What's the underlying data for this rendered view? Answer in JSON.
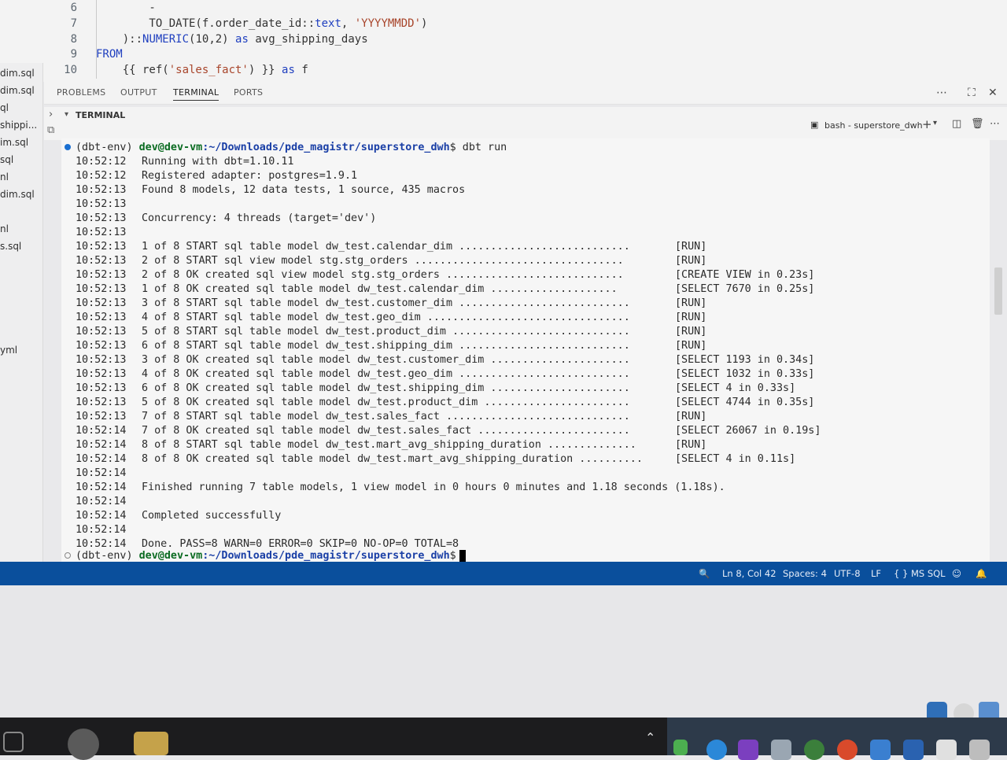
{
  "editor": {
    "lines": [
      {
        "num": "6",
        "parts": [
          {
            "t": "        -",
            "c": "fn"
          }
        ]
      },
      {
        "num": "7",
        "parts": [
          {
            "t": "        TO_DATE(f.order_date_id::",
            "c": "fn"
          },
          {
            "t": "text",
            "c": "kw"
          },
          {
            "t": ", ",
            "c": "fn"
          },
          {
            "t": "'YYYYMMDD'",
            "c": "str"
          },
          {
            "t": ")",
            "c": "fn"
          }
        ]
      },
      {
        "num": "8",
        "parts": [
          {
            "t": "    )::",
            "c": "fn"
          },
          {
            "t": "NUMERIC",
            "c": "kw"
          },
          {
            "t": "(10,2) ",
            "c": "fn"
          },
          {
            "t": "as",
            "c": "kw"
          },
          {
            "t": " avg_shipping_days",
            "c": "fn"
          }
        ]
      },
      {
        "num": "9",
        "parts": [
          {
            "t": "FROM",
            "c": "kw"
          }
        ]
      },
      {
        "num": "10",
        "parts": [
          {
            "t": "    {{ ref(",
            "c": "fn"
          },
          {
            "t": "'sales_fact'",
            "c": "str"
          },
          {
            "t": ") }} ",
            "c": "fn"
          },
          {
            "t": "as",
            "c": "kw"
          },
          {
            "t": " f",
            "c": "fn"
          }
        ]
      }
    ]
  },
  "explorer": {
    "items": [
      "dim.sql",
      "dim.sql",
      "ql",
      "shippi...",
      "im.sql",
      "sql",
      "nl",
      "dim.sql",
      "nl",
      "s.sql",
      "yml"
    ]
  },
  "panel": {
    "tabs": [
      "PROBLEMS",
      "OUTPUT",
      "TERMINAL",
      "PORTS"
    ],
    "active_tab": "TERMINAL",
    "terminal_section_label": "TERMINAL",
    "terminal_instance": "bash - superstore_dwh"
  },
  "terminal": {
    "prompt_env": "(dbt-env)",
    "prompt_user": "dev@dev-vm",
    "prompt_path": ":~/Downloads/pde_magistr/superstore_dwh",
    "prompt_symbol": "$",
    "command": " dbt run",
    "lines": [
      {
        "time": "10:52:12",
        "msg": "Running with dbt=1.10.11",
        "status": ""
      },
      {
        "time": "10:52:12",
        "msg": "Registered adapter: postgres=1.9.1",
        "status": ""
      },
      {
        "time": "10:52:13",
        "msg": "Found 8 models, 12 data tests, 1 source, 435 macros",
        "status": ""
      },
      {
        "time": "10:52:13",
        "msg": "",
        "status": ""
      },
      {
        "time": "10:52:13",
        "msg": "Concurrency: 4 threads (target='dev')",
        "status": ""
      },
      {
        "time": "10:52:13",
        "msg": "",
        "status": ""
      },
      {
        "time": "10:52:13",
        "msg": "1 of 8 START sql table model dw_test.calendar_dim ...........................",
        "status": "[RUN]"
      },
      {
        "time": "10:52:13",
        "msg": "2 of 8 START sql view model stg.stg_orders .................................",
        "status": "[RUN]"
      },
      {
        "time": "10:52:13",
        "msg": "2 of 8 OK created sql view model stg.stg_orders ............................",
        "status": "[CREATE VIEW in 0.23s]"
      },
      {
        "time": "10:52:13",
        "msg": "1 of 8 OK created sql table model dw_test.calendar_dim ....................",
        "status": "[SELECT 7670 in 0.25s]"
      },
      {
        "time": "10:52:13",
        "msg": "3 of 8 START sql table model dw_test.customer_dim ...........................",
        "status": "[RUN]"
      },
      {
        "time": "10:52:13",
        "msg": "4 of 8 START sql table model dw_test.geo_dim ................................",
        "status": "[RUN]"
      },
      {
        "time": "10:52:13",
        "msg": "5 of 8 START sql table model dw_test.product_dim ............................",
        "status": "[RUN]"
      },
      {
        "time": "10:52:13",
        "msg": "6 of 8 START sql table model dw_test.shipping_dim ...........................",
        "status": "[RUN]"
      },
      {
        "time": "10:52:13",
        "msg": "3 of 8 OK created sql table model dw_test.customer_dim ......................",
        "status": "[SELECT 1193 in 0.34s]"
      },
      {
        "time": "10:52:13",
        "msg": "4 of 8 OK created sql table model dw_test.geo_dim ...........................",
        "status": "[SELECT 1032 in 0.33s]"
      },
      {
        "time": "10:52:13",
        "msg": "6 of 8 OK created sql table model dw_test.shipping_dim ......................",
        "status": "[SELECT 4 in 0.33s]"
      },
      {
        "time": "10:52:13",
        "msg": "5 of 8 OK created sql table model dw_test.product_dim .......................",
        "status": "[SELECT 4744 in 0.35s]"
      },
      {
        "time": "10:52:13",
        "msg": "7 of 8 START sql table model dw_test.sales_fact .............................",
        "status": "[RUN]"
      },
      {
        "time": "10:52:14",
        "msg": "7 of 8 OK created sql table model dw_test.sales_fact ........................",
        "status": "[SELECT 26067 in 0.19s]"
      },
      {
        "time": "10:52:14",
        "msg": "8 of 8 START sql table model dw_test.mart_avg_shipping_duration ..............",
        "status": "[RUN]"
      },
      {
        "time": "10:52:14",
        "msg": "8 of 8 OK created sql table model dw_test.mart_avg_shipping_duration ..........",
        "status": "[SELECT 4 in 0.11s]"
      },
      {
        "time": "10:52:14",
        "msg": "",
        "status": ""
      },
      {
        "time": "10:52:14",
        "msg": "Finished running 7 table models, 1 view model in 0 hours 0 minutes and 1.18 seconds (1.18s).",
        "status": ""
      },
      {
        "time": "10:52:14",
        "msg": "",
        "status": ""
      },
      {
        "time": "10:52:14",
        "msg": "Completed successfully",
        "status": ""
      },
      {
        "time": "10:52:14",
        "msg": "",
        "status": ""
      },
      {
        "time": "10:52:14",
        "msg": "Done. PASS=8 WARN=0 ERROR=0 SKIP=0 NO-OP=0 TOTAL=8",
        "status": ""
      }
    ]
  },
  "statusbar": {
    "cursor_pos": "Ln 8, Col 42",
    "spaces": "Spaces: 4",
    "encoding": "UTF-8",
    "eol": "LF",
    "language": "{ } MS SQL"
  },
  "colors": {
    "statusbar_bg": "#0a4f9c",
    "prompt_user": "#0a6b21",
    "prompt_path": "#1a3fa6",
    "success_dot": "#1a6fd1"
  }
}
